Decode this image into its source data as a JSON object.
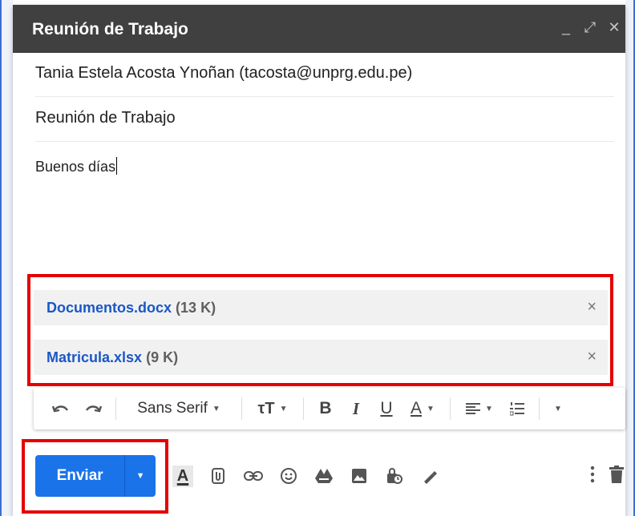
{
  "window": {
    "title": "Reunión de Trabajo",
    "controls": {
      "minimize": "_",
      "expand": "⤢",
      "close": "✕"
    }
  },
  "compose": {
    "to": "Tania Estela Acosta Ynoñan (tacosta@unprg.edu.pe)",
    "subject": "Reunión de Trabajo",
    "body": "Buenos días"
  },
  "attachments": [
    {
      "name": "Documentos.docx",
      "size": "(13 K)",
      "remove": "×"
    },
    {
      "name": "Matricula.xlsx",
      "size": "(9 K)",
      "remove": "×"
    }
  ],
  "toolbar": {
    "font": "Sans Serif",
    "bold": "B",
    "italic": "I",
    "underline": "U",
    "text_color": "A"
  },
  "footer": {
    "send_label": "Enviar",
    "formatting_letter": "A"
  },
  "colors": {
    "titlebar": "#404040",
    "send": "#1a73e8",
    "highlight": "#e50000",
    "attachment_link": "#1a57c6"
  }
}
